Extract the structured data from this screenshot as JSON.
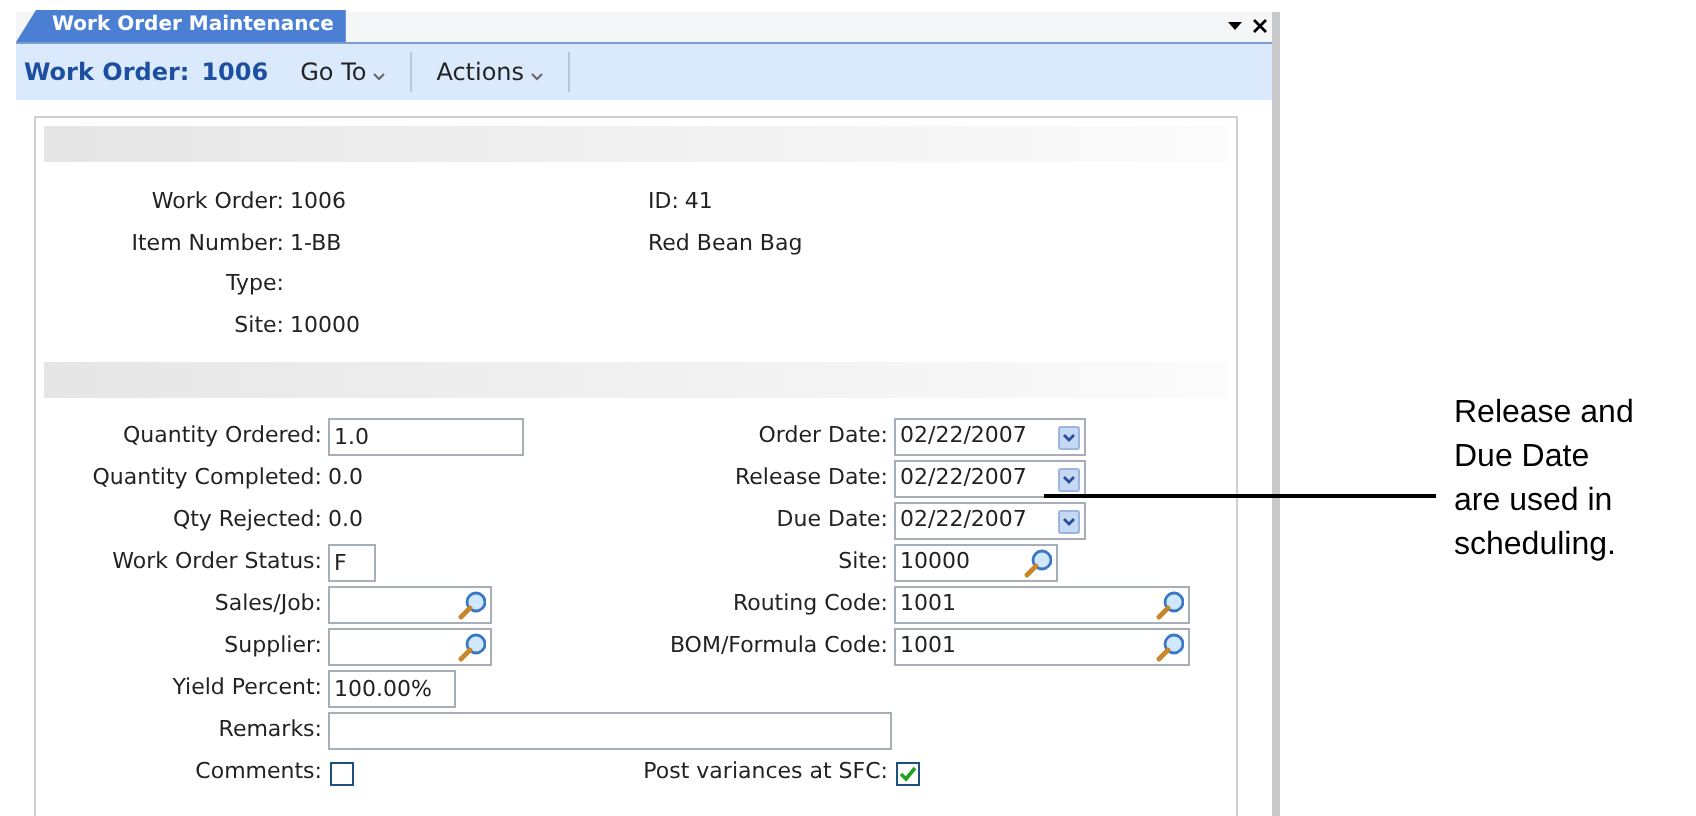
{
  "window": {
    "tab": "Work Order Maintenance"
  },
  "toolbar": {
    "label": "Work Order:",
    "number": "1006",
    "menus": [
      "Go To",
      "Actions"
    ]
  },
  "header": {
    "left": [
      {
        "label": "Work Order:",
        "value": "1006"
      },
      {
        "label": "Item Number:",
        "value": "1-BB"
      },
      {
        "label": "Type:"
      },
      {
        "label": "Site:",
        "value": "10000"
      }
    ],
    "right": [
      {
        "label": "ID:",
        "value": "41"
      },
      {
        "value": "Red Bean Bag"
      }
    ]
  },
  "form": [
    {
      "left": {
        "kind": "input",
        "label": "Quantity Ordered:",
        "value": "1.0"
      },
      "right": {
        "kind": "date",
        "label": "Order Date:",
        "value": "02/22/2007"
      }
    },
    {
      "left": {
        "kind": "text",
        "label": "Quantity Completed:",
        "value": "0.0"
      },
      "right": {
        "kind": "date",
        "label": "Release Date:",
        "value": "02/22/2007"
      }
    },
    {
      "left": {
        "kind": "text",
        "label": "Qty Rejected:",
        "value": "0.0"
      },
      "right": {
        "kind": "date",
        "label": "Due Date:",
        "value": "02/22/2007"
      }
    },
    {
      "left": {
        "kind": "input",
        "label": "Work Order Status:",
        "value": "F"
      },
      "right": {
        "kind": "lookup",
        "label": "Site:",
        "value": "10000"
      }
    },
    {
      "left": {
        "kind": "lookup",
        "label": "Sales/Job:"
      },
      "right": {
        "kind": "lookup",
        "label": "Routing Code:",
        "value": "1001"
      }
    },
    {
      "left": {
        "kind": "lookup",
        "label": "Supplier:"
      },
      "right": {
        "kind": "lookup",
        "label": "BOM/Formula Code:",
        "value": "1001"
      }
    },
    {
      "left": {
        "kind": "input",
        "label": "Yield Percent:",
        "value": "100.00%"
      }
    },
    {
      "left": {
        "kind": "input",
        "label": "Remarks:"
      }
    },
    {
      "left": {
        "kind": "checkbox",
        "label": "Comments:",
        "checked": false
      },
      "right": {
        "kind": "checkbox",
        "label": "Post variances at SFC:",
        "checked": true
      }
    }
  ],
  "callout": {
    "lines": [
      "Release and",
      "Due Date",
      "are used in",
      "scheduling."
    ]
  }
}
